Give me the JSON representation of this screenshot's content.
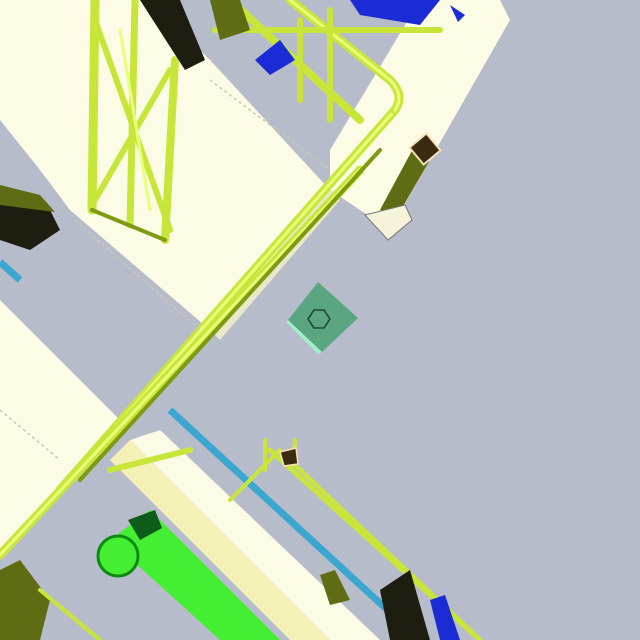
{
  "viewport": {
    "kind": "3d-plant-model-view",
    "colors": {
      "background": "#b7bccb",
      "deck": "#fbfbe6",
      "deck_edge": "#e9e9c9",
      "handrail": "#c8e63a",
      "handrail_dark": "#7e9a12",
      "handrail_light": "#e9ff7a",
      "steel_dark": "#1e1e10",
      "steel_olive": "#5e6d14",
      "pipe_cyan": "#3ba6cf",
      "pipe_green": "#44ee33",
      "equipment_blue": "#1b2bd6",
      "marker_green": "#5aa681"
    },
    "icons": {
      "selection_marker": "hexagon-in-square-icon"
    }
  }
}
